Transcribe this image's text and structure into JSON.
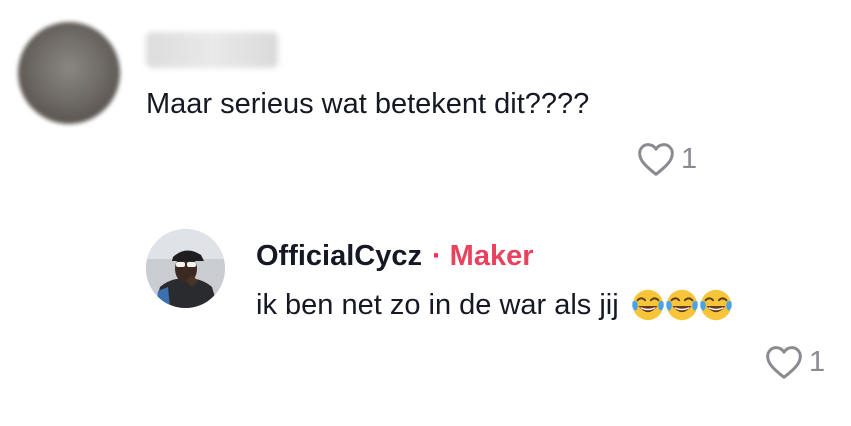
{
  "comment": {
    "author_redacted": true,
    "text": "Maar serieus wat betekent dit????",
    "likes": "1"
  },
  "reply": {
    "author": "OfficialCycz",
    "separator": "·",
    "badge": "Maker",
    "text": "ik ben net zo in de war als jij",
    "emojis": [
      "face-with-tears-of-joy",
      "face-with-tears-of-joy",
      "face-with-tears-of-joy"
    ],
    "likes": "1"
  },
  "colors": {
    "text": "#161823",
    "muted": "#8a8b91",
    "maker": "#e8435e"
  },
  "icons": {
    "like": "heart-outline-icon"
  }
}
